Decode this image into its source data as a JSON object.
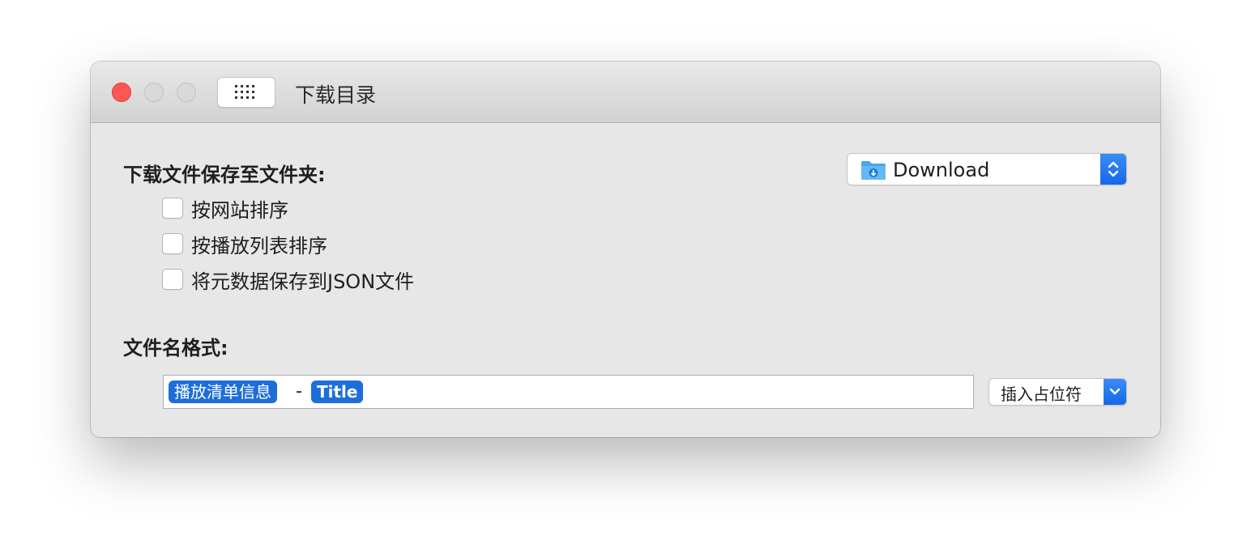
{
  "window": {
    "title": "下载目录",
    "traffic_lights": [
      "close",
      "minimize",
      "zoom"
    ],
    "toolbar_icon": "grid-icon"
  },
  "save_section": {
    "label": "下载文件保存至文件夹:",
    "folder_popup": {
      "icon": "download-folder-icon",
      "value": "Download"
    },
    "options": [
      {
        "label": "按网站排序",
        "checked": false
      },
      {
        "label": "按播放列表排序",
        "checked": false
      },
      {
        "label": "将元数据保存到JSON文件",
        "checked": false
      }
    ]
  },
  "filename_section": {
    "label": "文件名格式:",
    "tokens": [
      {
        "text": "播放清单信息"
      },
      {
        "text": "Title"
      }
    ],
    "separator": "-",
    "insert_button": {
      "label": "插入占位符"
    }
  },
  "colors": {
    "accent": "#1d6ed8",
    "close": "#fc5753",
    "window_bg": "#e7e7e7"
  }
}
